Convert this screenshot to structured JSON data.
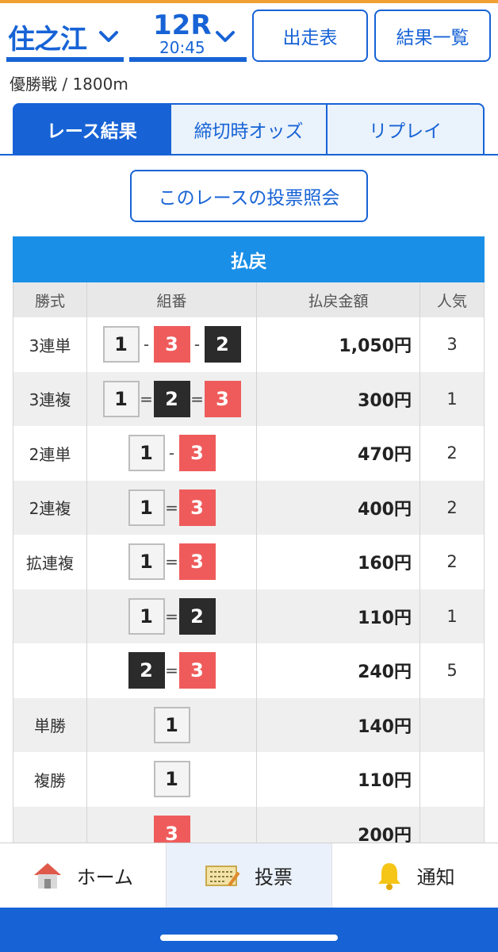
{
  "header": {
    "venue": "住之江",
    "race_number": "12R",
    "race_time": "20:45",
    "btn_entries": "出走表",
    "btn_results": "結果一覧"
  },
  "subinfo": "優勝戦 / 1800m",
  "tabs": [
    {
      "label": "レース結果",
      "active": true
    },
    {
      "label": "締切時オッズ",
      "active": false
    },
    {
      "label": "リプレイ",
      "active": false
    }
  ],
  "vote_inquiry_button": "このレースの投票照会",
  "payout": {
    "title": "払戻",
    "columns": [
      "勝式",
      "組番",
      "払戻金額",
      "人気"
    ],
    "rows": [
      {
        "type": "3連単",
        "boats": [
          "1",
          "3",
          "2"
        ],
        "sep": "-",
        "amount": "1,050円",
        "pop": "3"
      },
      {
        "type": "3連複",
        "boats": [
          "1",
          "2",
          "3"
        ],
        "sep": "=",
        "amount": "300円",
        "pop": "1"
      },
      {
        "type": "2連単",
        "boats": [
          "1",
          "3"
        ],
        "sep": "-",
        "amount": "470円",
        "pop": "2"
      },
      {
        "type": "2連複",
        "boats": [
          "1",
          "3"
        ],
        "sep": "=",
        "amount": "400円",
        "pop": "2"
      },
      {
        "type": "拡連複",
        "boats": [
          "1",
          "3"
        ],
        "sep": "=",
        "amount": "160円",
        "pop": "2"
      },
      {
        "type": "",
        "boats": [
          "1",
          "2"
        ],
        "sep": "=",
        "amount": "110円",
        "pop": "1"
      },
      {
        "type": "",
        "boats": [
          "2",
          "3"
        ],
        "sep": "=",
        "amount": "240円",
        "pop": "5"
      },
      {
        "type": "単勝",
        "boats": [
          "1"
        ],
        "sep": "",
        "amount": "140円",
        "pop": ""
      },
      {
        "type": "複勝",
        "boats": [
          "1"
        ],
        "sep": "",
        "amount": "110円",
        "pop": ""
      },
      {
        "type": "",
        "boats": [
          "3"
        ],
        "sep": "",
        "amount": "200円",
        "pop": ""
      }
    ]
  },
  "bottom_nav": [
    {
      "label": "ホーム",
      "icon": "house-icon",
      "active": false
    },
    {
      "label": "投票",
      "icon": "ticket-icon",
      "active": true
    },
    {
      "label": "通知",
      "icon": "bell-icon",
      "active": false
    }
  ],
  "colors": {
    "accent": "#1763d6",
    "header_bar": "#1a8fe8",
    "boat1": "#f4f4f4",
    "boat2": "#2b2b2b",
    "boat3": "#ef5b5b"
  }
}
